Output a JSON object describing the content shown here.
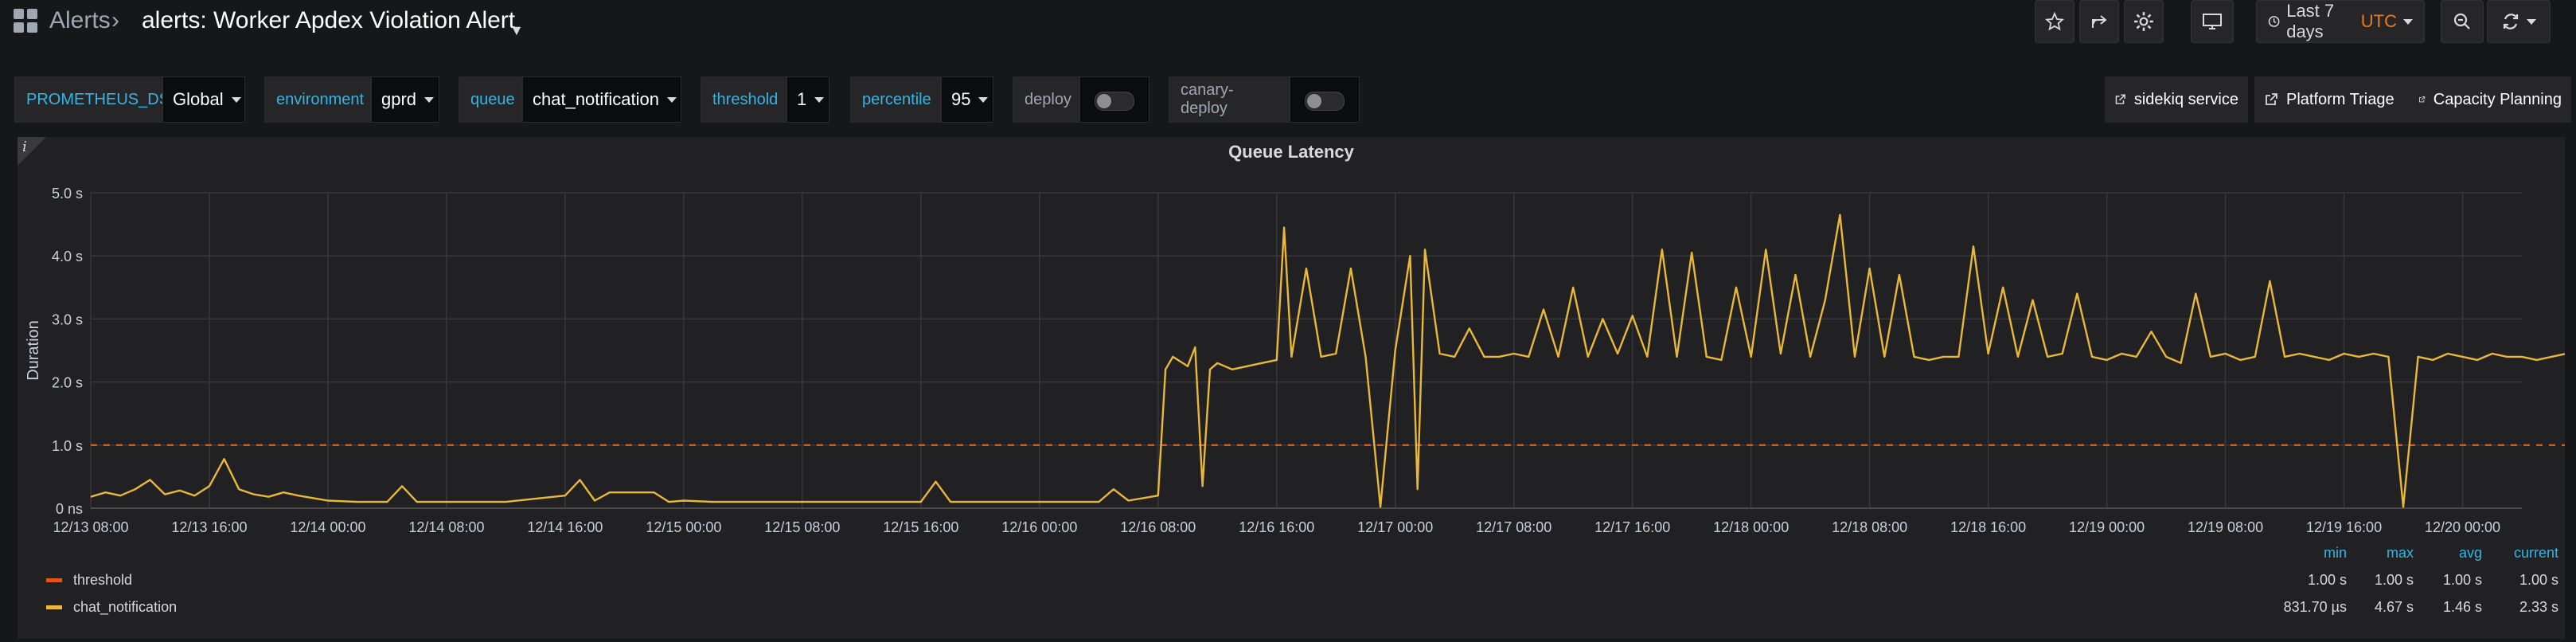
{
  "header": {
    "breadcrumb_root": "Alerts",
    "title": "alerts: Worker Apdex Violation Alert",
    "time_range": "Last 7 days",
    "timezone": "UTC"
  },
  "variables": [
    {
      "label": "PROMETHEUS_DS",
      "value": "Global"
    },
    {
      "label": "environment",
      "value": "gprd"
    },
    {
      "label": "queue",
      "value": "chat_notification"
    },
    {
      "label": "threshold",
      "value": "1"
    },
    {
      "label": "percentile",
      "value": "95"
    }
  ],
  "toggles": [
    {
      "label": "deploy",
      "on": false
    },
    {
      "label": "canary-deploy",
      "on": false
    }
  ],
  "links": [
    "sidekiq service",
    "Platform Triage",
    "Capacity Planning"
  ],
  "panel": {
    "info": "i",
    "title": "Queue Latency"
  },
  "chart_data": {
    "type": "line",
    "title": "Queue Latency",
    "ylabel": "Duration",
    "ylim": [
      0,
      5.0
    ],
    "y_ticks": [
      "0 ns",
      "1.0 s",
      "2.0 s",
      "3.0 s",
      "4.0 s",
      "5.0 s"
    ],
    "x_ticks": [
      "12/13 08:00",
      "12/13 16:00",
      "12/14 00:00",
      "12/14 08:00",
      "12/14 16:00",
      "12/15 00:00",
      "12/15 08:00",
      "12/15 16:00",
      "12/16 00:00",
      "12/16 08:00",
      "12/16 16:00",
      "12/17 00:00",
      "12/17 08:00",
      "12/17 16:00",
      "12/18 00:00",
      "12/18 08:00",
      "12/18 16:00",
      "12/19 00:00",
      "12/19 08:00",
      "12/19 16:00",
      "12/20 00:00"
    ],
    "grid": true,
    "colors": {
      "threshold": "#e0541a",
      "chat_notification": "#eab839"
    },
    "series": [
      {
        "name": "threshold",
        "style": "dashed",
        "points": [
          [
            "12/13 08:00",
            1.0
          ],
          [
            "12/20 12:00",
            1.0
          ]
        ]
      },
      {
        "name": "chat_notification",
        "points": [
          [
            "12/13 08:00",
            0.18
          ],
          [
            "12/13 09:00",
            0.25
          ],
          [
            "12/13 10:00",
            0.2
          ],
          [
            "12/13 11:00",
            0.3
          ],
          [
            "12/13 12:00",
            0.45
          ],
          [
            "12/13 13:00",
            0.22
          ],
          [
            "12/13 14:00",
            0.28
          ],
          [
            "12/13 15:00",
            0.2
          ],
          [
            "12/13 16:00",
            0.35
          ],
          [
            "12/13 17:00",
            0.78
          ],
          [
            "12/13 18:00",
            0.3
          ],
          [
            "12/13 19:00",
            0.22
          ],
          [
            "12/13 20:00",
            0.18
          ],
          [
            "12/13 21:00",
            0.25
          ],
          [
            "12/13 22:00",
            0.2
          ],
          [
            "12/14 00:00",
            0.12
          ],
          [
            "12/14 02:00",
            0.1
          ],
          [
            "12/14 04:00",
            0.1
          ],
          [
            "12/14 05:00",
            0.35
          ],
          [
            "12/14 06:00",
            0.1
          ],
          [
            "12/14 08:00",
            0.1
          ],
          [
            "12/14 10:00",
            0.1
          ],
          [
            "12/14 12:00",
            0.1
          ],
          [
            "12/14 14:00",
            0.15
          ],
          [
            "12/14 16:00",
            0.2
          ],
          [
            "12/14 17:00",
            0.45
          ],
          [
            "12/14 18:00",
            0.12
          ],
          [
            "12/14 19:00",
            0.25
          ],
          [
            "12/14 20:00",
            0.25
          ],
          [
            "12/14 22:00",
            0.25
          ],
          [
            "12/14 23:00",
            0.1
          ],
          [
            "12/15 00:00",
            0.12
          ],
          [
            "12/15 02:00",
            0.1
          ],
          [
            "12/15 04:00",
            0.1
          ],
          [
            "12/15 06:00",
            0.1
          ],
          [
            "12/15 08:00",
            0.1
          ],
          [
            "12/15 10:00",
            0.1
          ],
          [
            "12/15 12:00",
            0.1
          ],
          [
            "12/15 14:00",
            0.1
          ],
          [
            "12/15 16:00",
            0.1
          ],
          [
            "12/15 17:00",
            0.42
          ],
          [
            "12/15 18:00",
            0.1
          ],
          [
            "12/15 20:00",
            0.1
          ],
          [
            "12/15 22:00",
            0.1
          ],
          [
            "12/16 00:00",
            0.1
          ],
          [
            "12/16 02:00",
            0.1
          ],
          [
            "12/16 04:00",
            0.1
          ],
          [
            "12/16 05:00",
            0.3
          ],
          [
            "12/16 06:00",
            0.12
          ],
          [
            "12/16 08:00",
            0.2
          ],
          [
            "12/16 08:30",
            2.2
          ],
          [
            "12/16 09:00",
            2.4
          ],
          [
            "12/16 10:00",
            2.25
          ],
          [
            "12/16 10:30",
            2.55
          ],
          [
            "12/16 11:00",
            0.35
          ],
          [
            "12/16 11:30",
            2.2
          ],
          [
            "12/16 12:00",
            2.3
          ],
          [
            "12/16 13:00",
            2.2
          ],
          [
            "12/16 14:00",
            2.25
          ],
          [
            "12/16 15:00",
            2.3
          ],
          [
            "12/16 16:00",
            2.35
          ],
          [
            "12/16 16:30",
            4.45
          ],
          [
            "12/16 17:00",
            2.4
          ],
          [
            "12/16 18:00",
            3.8
          ],
          [
            "12/16 19:00",
            2.4
          ],
          [
            "12/16 20:00",
            2.45
          ],
          [
            "12/16 21:00",
            3.8
          ],
          [
            "12/16 22:00",
            2.4
          ],
          [
            "12/16 23:00",
            0.02
          ],
          [
            "12/17 00:00",
            2.5
          ],
          [
            "12/17 01:00",
            4.0
          ],
          [
            "12/17 01:30",
            0.3
          ],
          [
            "12/17 02:00",
            4.1
          ],
          [
            "12/17 03:00",
            2.45
          ],
          [
            "12/17 04:00",
            2.4
          ],
          [
            "12/17 05:00",
            2.85
          ],
          [
            "12/17 06:00",
            2.4
          ],
          [
            "12/17 07:00",
            2.4
          ],
          [
            "12/17 08:00",
            2.45
          ],
          [
            "12/17 09:00",
            2.4
          ],
          [
            "12/17 10:00",
            3.15
          ],
          [
            "12/17 11:00",
            2.4
          ],
          [
            "12/17 12:00",
            3.5
          ],
          [
            "12/17 13:00",
            2.4
          ],
          [
            "12/17 14:00",
            3.0
          ],
          [
            "12/17 15:00",
            2.45
          ],
          [
            "12/17 16:00",
            3.05
          ],
          [
            "12/17 17:00",
            2.4
          ],
          [
            "12/17 18:00",
            4.1
          ],
          [
            "12/17 19:00",
            2.4
          ],
          [
            "12/17 20:00",
            4.05
          ],
          [
            "12/17 21:00",
            2.4
          ],
          [
            "12/17 22:00",
            2.35
          ],
          [
            "12/17 23:00",
            3.5
          ],
          [
            "12/18 00:00",
            2.4
          ],
          [
            "12/18 01:00",
            4.1
          ],
          [
            "12/18 02:00",
            2.45
          ],
          [
            "12/18 03:00",
            3.7
          ],
          [
            "12/18 04:00",
            2.4
          ],
          [
            "12/18 05:00",
            3.3
          ],
          [
            "12/18 06:00",
            4.65
          ],
          [
            "12/18 07:00",
            2.4
          ],
          [
            "12/18 08:00",
            3.8
          ],
          [
            "12/18 09:00",
            2.4
          ],
          [
            "12/18 10:00",
            3.7
          ],
          [
            "12/18 11:00",
            2.4
          ],
          [
            "12/18 12:00",
            2.35
          ],
          [
            "12/18 13:00",
            2.4
          ],
          [
            "12/18 14:00",
            2.4
          ],
          [
            "12/18 15:00",
            4.15
          ],
          [
            "12/18 16:00",
            2.45
          ],
          [
            "12/18 17:00",
            3.5
          ],
          [
            "12/18 18:00",
            2.4
          ],
          [
            "12/18 19:00",
            3.3
          ],
          [
            "12/18 20:00",
            2.4
          ],
          [
            "12/18 21:00",
            2.45
          ],
          [
            "12/18 22:00",
            3.4
          ],
          [
            "12/18 23:00",
            2.4
          ],
          [
            "12/19 00:00",
            2.35
          ],
          [
            "12/19 01:00",
            2.45
          ],
          [
            "12/19 02:00",
            2.4
          ],
          [
            "12/19 03:00",
            2.8
          ],
          [
            "12/19 04:00",
            2.4
          ],
          [
            "12/19 05:00",
            2.3
          ],
          [
            "12/19 06:00",
            3.4
          ],
          [
            "12/19 07:00",
            2.4
          ],
          [
            "12/19 08:00",
            2.45
          ],
          [
            "12/19 09:00",
            2.35
          ],
          [
            "12/19 10:00",
            2.4
          ],
          [
            "12/19 11:00",
            3.6
          ],
          [
            "12/19 12:00",
            2.4
          ],
          [
            "12/19 13:00",
            2.45
          ],
          [
            "12/19 14:00",
            2.4
          ],
          [
            "12/19 15:00",
            2.35
          ],
          [
            "12/19 16:00",
            2.45
          ],
          [
            "12/19 17:00",
            2.4
          ],
          [
            "12/19 18:00",
            2.45
          ],
          [
            "12/19 19:00",
            2.4
          ],
          [
            "12/19 20:00",
            0.02
          ],
          [
            "12/19 21:00",
            2.4
          ],
          [
            "12/19 22:00",
            2.35
          ],
          [
            "12/19 23:00",
            2.45
          ],
          [
            "12/20 00:00",
            2.4
          ],
          [
            "12/20 01:00",
            2.35
          ],
          [
            "12/20 02:00",
            2.45
          ],
          [
            "12/20 03:00",
            2.4
          ],
          [
            "12/20 04:00",
            2.4
          ],
          [
            "12/20 05:00",
            2.35
          ],
          [
            "12/20 06:00",
            2.4
          ],
          [
            "12/20 07:00",
            2.45
          ],
          [
            "12/20 08:00",
            2.4
          ],
          [
            "12/20 09:00",
            2.4
          ],
          [
            "12/20 10:00",
            2.35
          ],
          [
            "12/20 11:00",
            2.4
          ],
          [
            "12/20 12:00",
            2.35
          ]
        ]
      }
    ]
  },
  "legend": {
    "headers": [
      "min",
      "max",
      "avg",
      "current"
    ],
    "rows": [
      {
        "name": "threshold",
        "min": "1.00 s",
        "max": "1.00 s",
        "avg": "1.00 s",
        "current": "1.00 s"
      },
      {
        "name": "chat_notification",
        "min": "831.70 µs",
        "max": "4.67 s",
        "avg": "1.46 s",
        "current": "2.33 s"
      }
    ]
  }
}
